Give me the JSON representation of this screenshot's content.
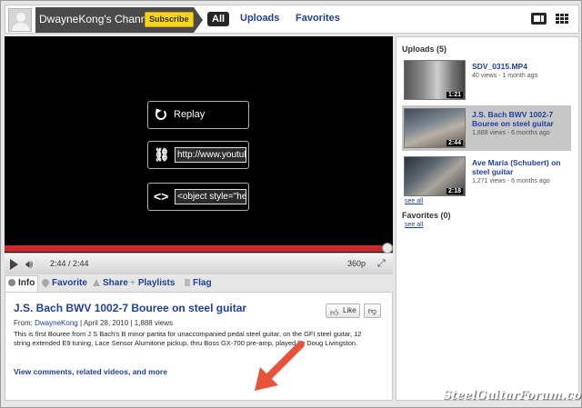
{
  "header": {
    "channel_name": "DwayneKong's Channel",
    "subscribe_label": "Subscribe",
    "tabs": [
      {
        "label": "All"
      },
      {
        "label": "Uploads"
      },
      {
        "label": "Favorites"
      }
    ]
  },
  "player": {
    "replay_label": "Replay",
    "share_url": "http://www.youtub",
    "embed_code": "<object style=\"hei",
    "time": "2:44 / 2:44",
    "quality": "360p",
    "progress": 1.0
  },
  "info_tabs": [
    {
      "label": "Info"
    },
    {
      "label": "Favorite"
    },
    {
      "label": "Share"
    },
    {
      "label": "Playlists"
    },
    {
      "label": "Flag"
    }
  ],
  "info": {
    "title": "J.S. Bach BWV 1002-7 Bouree on steel guitar",
    "from_label": "From:",
    "author": "DwayneKong",
    "date": "April 28, 2010",
    "views": "1,888 views",
    "description": "This is first Bouree from J S Bach's B minor partita for unaccompanied pedal steel guitar, on the GFI steel guitar, 12 string extended E9 tuning, Lace Sensor Alumitone pickup, thru Boss GX-700 pre-amp, played by Doug Livingston.",
    "like_label": "Like",
    "more_link": "View comments, related videos, and more"
  },
  "sidebar": {
    "uploads_heading": "Uploads (5)",
    "uploads": [
      {
        "title": "SDV_0315.MP4",
        "meta": "40 views - 1 month ago",
        "duration": "1:21"
      },
      {
        "title": "J.S. Bach BWV 1002-7 Bouree on steel guitar",
        "meta": "1,888 views - 6 months ago",
        "duration": "2:44"
      },
      {
        "title": "Ave Maria (Schubert) on steel guitar",
        "meta": "1,271 views - 6 months ago",
        "duration": "2:18"
      }
    ],
    "see_all_label": "see all",
    "favorites_heading": "Favorites (0)"
  },
  "watermark": "SteelGuitarForum.com",
  "colors": {
    "accent_link": "#1f3f9e",
    "subscribe_bg": "#f6d31c",
    "progress_red": "#cc2a2a"
  }
}
